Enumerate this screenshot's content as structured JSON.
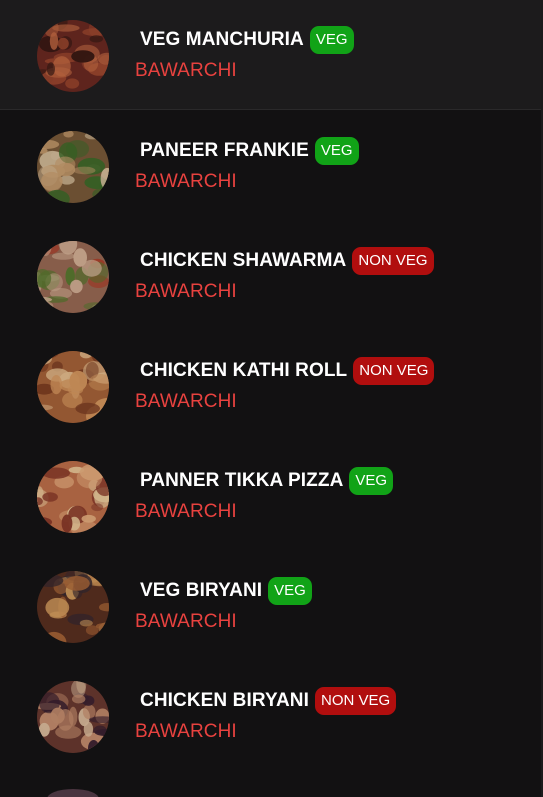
{
  "menu": {
    "items": [
      {
        "name": "VEG MANCHURIA",
        "badge": "VEG",
        "type": "veg",
        "vendor": "BAWARCHI",
        "image": "veg-manchuria-image",
        "palette": [
          "#6b2a22",
          "#a24a30",
          "#3a1a14",
          "#c96d45"
        ]
      },
      {
        "name": "PANEER FRANKIE",
        "badge": "VEG",
        "type": "veg",
        "vendor": "BAWARCHI",
        "image": "paneer-frankie-image",
        "palette": [
          "#7a5a3a",
          "#caa070",
          "#3e6b2a",
          "#d9c2a0"
        ]
      },
      {
        "name": "CHICKEN SHAWARMA",
        "badge": "NON VEG",
        "type": "nonveg",
        "vendor": "BAWARCHI",
        "image": "chicken-shawarma-image",
        "palette": [
          "#9a6a55",
          "#d8b59a",
          "#5a7a30",
          "#b0402a"
        ]
      },
      {
        "name": "CHICKEN KATHI ROLL",
        "badge": "NON VEG",
        "type": "nonveg",
        "vendor": "BAWARCHI",
        "image": "chicken-kathi-roll-image",
        "palette": [
          "#a8643a",
          "#d99a60",
          "#7a3a20",
          "#e8c090"
        ]
      },
      {
        "name": "PANNER TIKKA PIZZA",
        "badge": "VEG",
        "type": "veg",
        "vendor": "BAWARCHI",
        "image": "panner-tikka-pizza-image",
        "palette": [
          "#c0704a",
          "#e8b080",
          "#8a3a2a",
          "#f0d0a0"
        ]
      },
      {
        "name": "VEG BIRYANI",
        "badge": "VEG",
        "type": "veg",
        "vendor": "BAWARCHI",
        "image": "veg-biryani-image",
        "palette": [
          "#5a3020",
          "#b06a3a",
          "#3a2a30",
          "#d8a060"
        ]
      },
      {
        "name": "CHICKEN BIRYANI",
        "badge": "NON VEG",
        "type": "nonveg",
        "vendor": "BAWARCHI",
        "image": "chicken-biryani-image",
        "palette": [
          "#6a3a30",
          "#c89070",
          "#3a2030",
          "#e0c0a0"
        ]
      }
    ]
  }
}
